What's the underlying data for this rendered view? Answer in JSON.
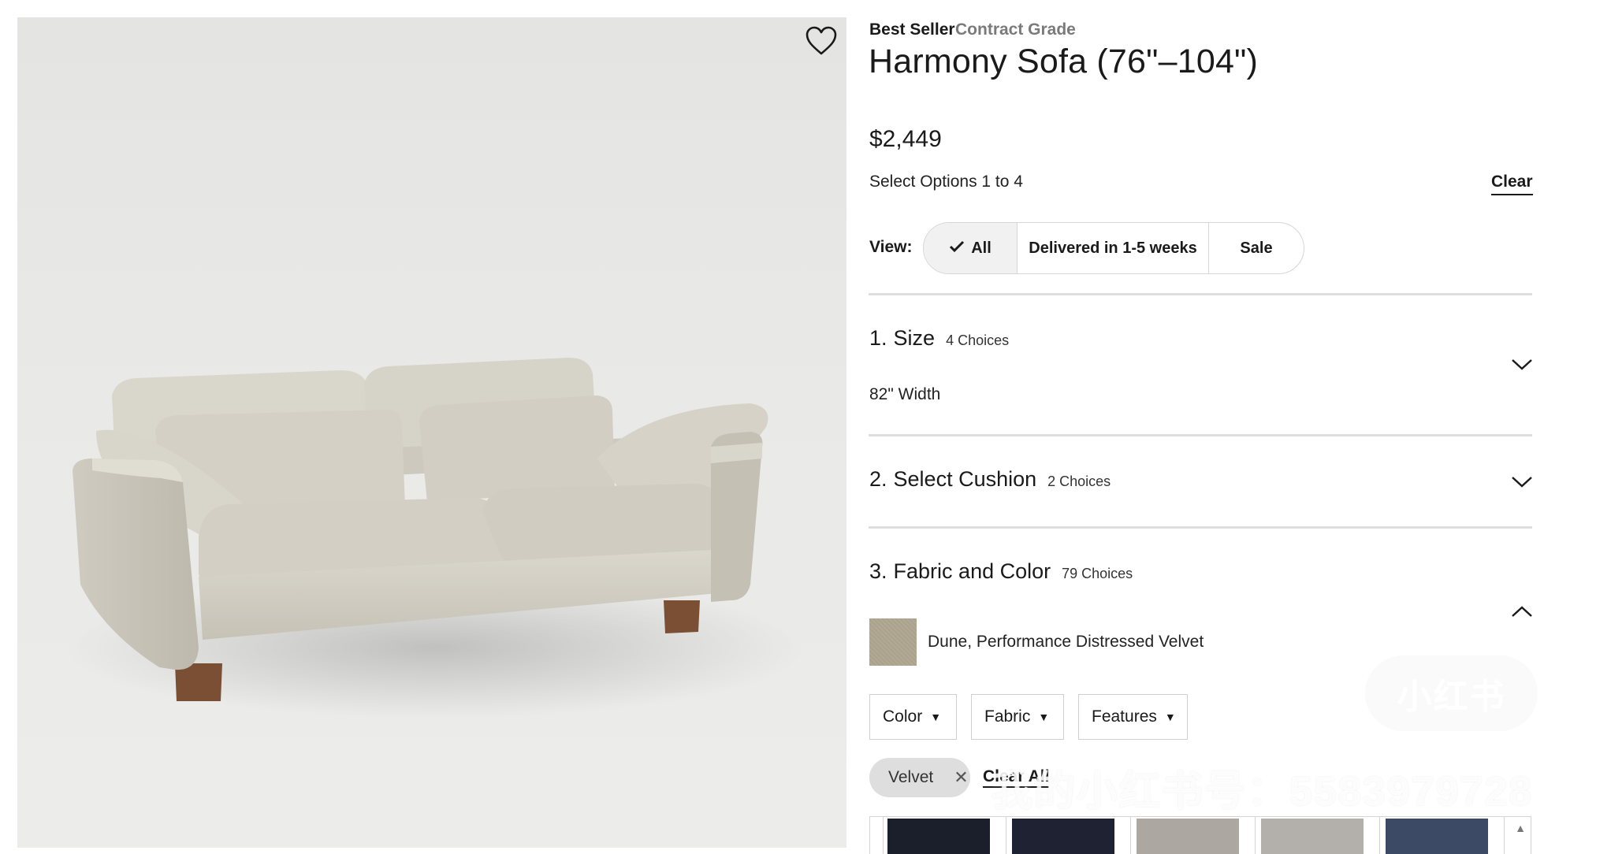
{
  "product": {
    "badges": {
      "best_seller": "Best Seller",
      "contract_grade": "Contract Grade"
    },
    "title": "Harmony Sofa (76\"–104\")",
    "price": "$2,449",
    "options_label": "Select Options 1 to 4",
    "clear_label": "Clear",
    "favorite_icon": "heart-outline-icon"
  },
  "view_filter": {
    "label": "View:",
    "options": [
      {
        "label": "All",
        "selected": true,
        "icon": "checkmark-icon"
      },
      {
        "label": "Delivered in 1-5 weeks",
        "selected": false
      },
      {
        "label": "Sale",
        "selected": false
      }
    ]
  },
  "sections": [
    {
      "number": "1.",
      "title": "Size",
      "choices": "4 Choices",
      "selected": "82\" Width",
      "expanded": false
    },
    {
      "number": "2.",
      "title": "Select Cushion",
      "choices": "2 Choices",
      "expanded": false
    },
    {
      "number": "3.",
      "title": "Fabric and Color",
      "choices": "79 Choices",
      "selected": "Dune, Performance Distressed Velvet",
      "expanded": true
    }
  ],
  "fabric_filters": {
    "dropdowns": [
      {
        "label": "Color"
      },
      {
        "label": "Fabric"
      },
      {
        "label": "Features"
      }
    ],
    "active_chips": [
      {
        "label": "Velvet",
        "remove_icon": "close-icon"
      }
    ],
    "clear_all_label": "Clear All"
  },
  "swatches": [
    {
      "color": "#1b1f2c"
    },
    {
      "color": "#1f2233"
    },
    {
      "color": "#aca7a1"
    },
    {
      "color": "#b3afab"
    },
    {
      "color": "#3c4a66"
    }
  ],
  "watermark": {
    "badge": "小红书",
    "text": "我的小红书号：5583979728"
  },
  "colors": {
    "text": "#1a1a1a",
    "muted": "#7a7a7a",
    "border": "#d6d6d6",
    "divider": "#dedede"
  }
}
